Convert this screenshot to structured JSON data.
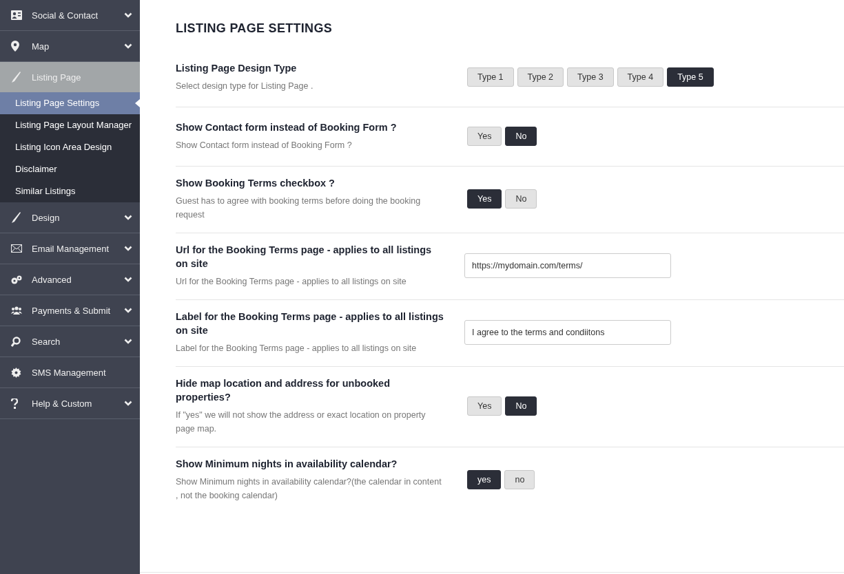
{
  "sidebar": {
    "items": [
      {
        "label": "Social & Contact",
        "chevron": true,
        "expanded": false
      },
      {
        "label": "Map",
        "chevron": true,
        "expanded": false
      },
      {
        "label": "Listing Page",
        "chevron": false,
        "expanded": true,
        "children": [
          {
            "label": "Listing Page Settings",
            "selected": true
          },
          {
            "label": "Listing Page Layout Manager",
            "selected": false
          },
          {
            "label": "Listing Icon Area Design",
            "selected": false
          },
          {
            "label": "Disclaimer",
            "selected": false
          },
          {
            "label": "Similar Listings",
            "selected": false
          }
        ]
      },
      {
        "label": "Design",
        "chevron": true,
        "expanded": false
      },
      {
        "label": "Email Management",
        "chevron": true,
        "expanded": false
      },
      {
        "label": "Advanced",
        "chevron": true,
        "expanded": false
      },
      {
        "label": "Payments & Submit",
        "chevron": true,
        "expanded": false
      },
      {
        "label": "Search",
        "chevron": true,
        "expanded": false
      },
      {
        "label": "SMS Management",
        "chevron": false,
        "expanded": false
      },
      {
        "label": "Help & Custom",
        "chevron": true,
        "expanded": false
      }
    ]
  },
  "page": {
    "title": "LISTING PAGE SETTINGS",
    "settings": [
      {
        "kind": "choice",
        "label": "Listing Page Design Type",
        "description": "Select design type for Listing Page .",
        "options": [
          {
            "label": "Type 1",
            "selected": false
          },
          {
            "label": "Type 2",
            "selected": false
          },
          {
            "label": "Type 3",
            "selected": false
          },
          {
            "label": "Type 4",
            "selected": false
          },
          {
            "label": "Type 5",
            "selected": true
          }
        ]
      },
      {
        "kind": "choice",
        "label": "Show Contact form instead of Booking Form ?",
        "description": "Show Contact form instead of Booking Form ?",
        "options": [
          {
            "label": "Yes",
            "selected": false
          },
          {
            "label": "No",
            "selected": true
          }
        ]
      },
      {
        "kind": "choice",
        "label": "Show Booking Terms checkbox ?",
        "description": "Guest has to agree with booking terms before doing the booking request",
        "options": [
          {
            "label": "Yes",
            "selected": true
          },
          {
            "label": "No",
            "selected": false
          }
        ]
      },
      {
        "kind": "text",
        "label": "Url for the Booking Terms page - applies to all listings on site",
        "description": "Url for the Booking Terms page - applies to all listings on site",
        "value": "https://mydomain.com/terms/"
      },
      {
        "kind": "text",
        "label": "Label for the Booking Terms page - applies to all listings on site",
        "description": "Label for the Booking Terms page - applies to all listings on site",
        "value": "I agree to the terms and condiitons"
      },
      {
        "kind": "choice",
        "label": "Hide map location and address for unbooked properties?",
        "description": "If \"yes\" we will not show the address or exact location on property page map.",
        "options": [
          {
            "label": "Yes",
            "selected": false
          },
          {
            "label": "No",
            "selected": true
          }
        ]
      },
      {
        "kind": "choice",
        "label": "Show Minimum nights in availability calendar?",
        "description": "Show Minimum nights in availability calendar?(the calendar in content , not the booking calendar)",
        "options": [
          {
            "label": "yes",
            "selected": true
          },
          {
            "label": "no",
            "selected": false
          }
        ]
      }
    ]
  }
}
